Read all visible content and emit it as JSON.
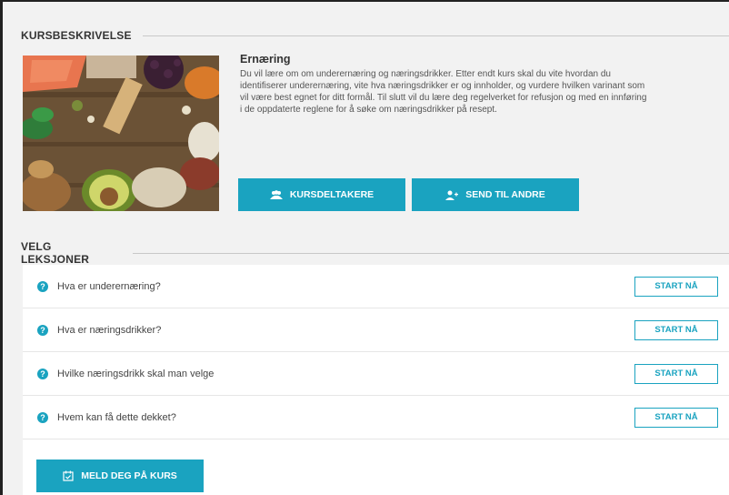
{
  "course_section": {
    "heading": "KURSBESKRIVELSE",
    "title": "Ernæring",
    "description": "Du vil lære om om underernæring og næringsdrikker. Etter endt kurs skal du vite hvordan du identifiserer underernæring, vite hva næringsdrikker er og innholder, og vurdere hvilken varinant som vil være best egnet for ditt formål. Til slutt vil du lære deg regelverket for refusjon og med en innføring i de oppdaterte reglene for å søke om næringsdrikker på resept.",
    "participants_button": "KURSDELTAKERE",
    "send_button": "SEND TIL ANDRE"
  },
  "lessons_section": {
    "heading": "VELG LEKSJONER",
    "lessons": [
      {
        "title": "Hva er underernæring?",
        "action": "START NÅ"
      },
      {
        "title": "Hva er næringsdrikker?",
        "action": "START NÅ"
      },
      {
        "title": "Hvilke næringsdrikk skal man velge",
        "action": "START NÅ"
      },
      {
        "title": "Hvem kan få dette dekket?",
        "action": "START NÅ"
      }
    ],
    "enroll_button": "MELD DEG PÅ KURS"
  },
  "colors": {
    "accent": "#1aa3c0",
    "background": "#f2f2f2"
  },
  "icons": {
    "participants": "users-icon",
    "send": "user-plus-icon",
    "lesson": "question-circle-icon",
    "enroll": "calendar-check-icon"
  }
}
